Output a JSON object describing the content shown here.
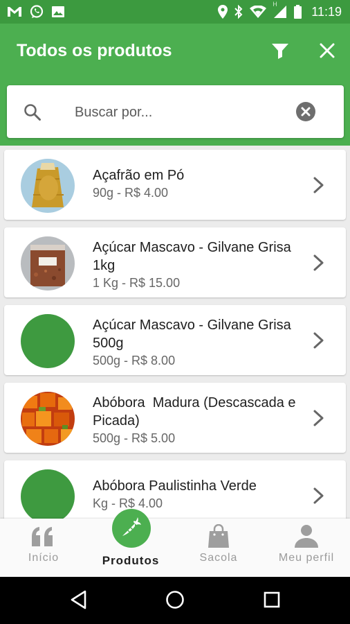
{
  "status_bar": {
    "time": "11:19",
    "left_icons": [
      "gmail-icon",
      "whatsapp-icon",
      "image-icon"
    ],
    "right_icons": [
      "location-icon",
      "bluetooth-icon",
      "wifi-icon",
      "signal-icon",
      "battery-icon"
    ],
    "network_label": "H"
  },
  "app_bar": {
    "title": "Todos os produtos",
    "filter_icon": "filter-icon",
    "close_icon": "close-icon"
  },
  "search": {
    "placeholder": "Buscar por...",
    "value": ""
  },
  "products": [
    {
      "name": "Açafrão em Pó",
      "price": "90g - R$ 4.00",
      "image": "saffron-bag"
    },
    {
      "name": "Açúcar Mascavo - Gilvane Grisa 1kg",
      "price": "1 Kg - R$ 15.00",
      "image": "sugar-bag"
    },
    {
      "name": "Açúcar Mascavo - Gilvane Grisa 500g",
      "price": "500g - R$ 8.00",
      "image": "placeholder-circle"
    },
    {
      "name": "Abóbora  Madura (Descascada e Picada)",
      "price": "500g - R$ 5.00",
      "image": "pumpkin-cubes"
    },
    {
      "name": "Abóbora Paulistinha Verde",
      "price": "Kg - R$ 4.00",
      "image": "placeholder-circle"
    }
  ],
  "bottom_nav": {
    "items": [
      {
        "label": "Início",
        "icon": "quote-icon",
        "active": false
      },
      {
        "label": "Produtos",
        "icon": "carrot-icon",
        "active": true
      },
      {
        "label": "Sacola",
        "icon": "bag-icon",
        "active": false
      },
      {
        "label": "Meu perfil",
        "icon": "user-icon",
        "active": false
      }
    ]
  },
  "colors": {
    "primary": "#4caf50",
    "status_bar": "#3c9a3f",
    "placeholder_circle": "#3e9a40"
  }
}
